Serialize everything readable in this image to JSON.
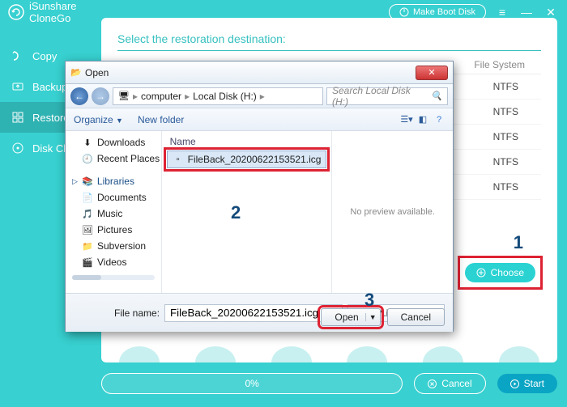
{
  "titlebar": {
    "brand1": "iSunshare",
    "brand2": "CloneGo",
    "make_boot": "Make Boot Disk"
  },
  "sidebar": {
    "items": [
      {
        "label": "Copy"
      },
      {
        "label": "Backup"
      },
      {
        "label": "Restore"
      },
      {
        "label": "Disk Clone"
      }
    ]
  },
  "main": {
    "heading": "Select the restoration destination:",
    "col_fs": "File System",
    "fs_value": "NTFS",
    "choose": "Choose"
  },
  "bottom": {
    "progress": "0%",
    "cancel": "Cancel",
    "start": "Start"
  },
  "dialog": {
    "title": "Open",
    "breadcrumb": {
      "a": "computer",
      "b": "Local Disk (H:)"
    },
    "search_placeholder": "Search Local Disk (H:)",
    "organize": "Organize",
    "newfolder": "New folder",
    "navpane": {
      "downloads": "Downloads",
      "recent": "Recent Places",
      "libraries": "Libraries",
      "documents": "Documents",
      "music": "Music",
      "pictures": "Pictures",
      "subversion": "Subversion",
      "videos": "Videos"
    },
    "col_name": "Name",
    "file": "FileBack_20200622153521.icg",
    "preview": "No preview available.",
    "filename_label": "File name:",
    "filename_value": "FileBack_20200622153521.icg",
    "filter": "Files (*.icg,*.icg)",
    "open": "Open",
    "cancel": "Cancel"
  },
  "annotations": {
    "n1": "1",
    "n2": "2",
    "n3": "3"
  }
}
